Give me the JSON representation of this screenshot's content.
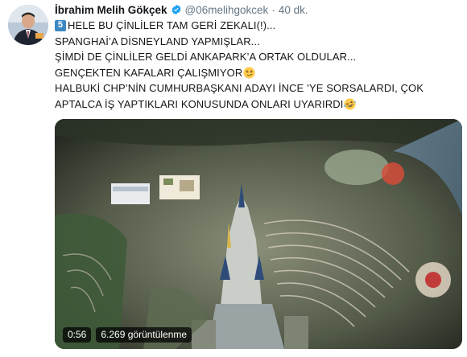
{
  "author": {
    "name": "İbrahim Melih Gökçek",
    "handle": "@06melihgokcek",
    "separator": "·",
    "time": "40 dk."
  },
  "tweet": {
    "keycap_number": "5",
    "line1": "HELE BU ÇİNLİLER TAM GERİ ZEKALI(!)...",
    "line2": "SPANGHAİ’A DİSNEYLAND YAPMIŞLAR...",
    "line3": "ŞİMDİ DE ÇİNLİLER GELDİ ANKAPARK’A ORTAK OLDULAR...",
    "line4": "GENÇEKTEN KAFALARI ÇALIŞMIYOR",
    "line5": "HALBUKİ CHP’NİN CUMHURBAŞKANI ADAYI İNCE ’YE SORSALARDI, ÇOK",
    "line6": "APTALCA İŞ YAPTIKLARI KONUSUNDA ONLARI UYARIRDI",
    "emoji1": "smirk-face",
    "emoji2": "rolling-laughing-face"
  },
  "video": {
    "duration": "0:56",
    "views": "6.269 görüntülenme"
  },
  "colors": {
    "verified_blue": "#1da1f2",
    "secondary_text": "#657786",
    "keycap_blue": "#3b88c3"
  }
}
